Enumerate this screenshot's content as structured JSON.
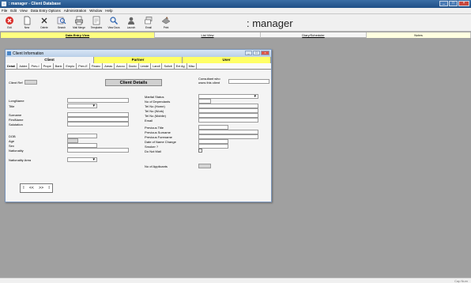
{
  "window": {
    "title": ": manager - Client Database"
  },
  "menu": [
    "File",
    "Edit",
    "View",
    "Data Entry Options",
    "Administration",
    "Window",
    "Help"
  ],
  "toolbar": [
    {
      "label": "Exit",
      "icon": "exit-icon"
    },
    {
      "label": "New",
      "icon": "new-document-icon"
    },
    {
      "label": "Delete",
      "icon": "delete-icon"
    },
    {
      "label": "Search",
      "icon": "search-icon"
    },
    {
      "label": "Mail Merge",
      "icon": "printer-icon"
    },
    {
      "label": "Templates",
      "icon": "templates-icon"
    },
    {
      "label": "View Docs",
      "icon": "view-docs-icon"
    },
    {
      "label": "Launch",
      "icon": "launch-icon"
    },
    {
      "label": "Email",
      "icon": "email-icon"
    },
    {
      "label": "Print",
      "icon": "print-icon"
    }
  ],
  "brand": ": manager",
  "view_tabs": [
    "Data Entry View",
    "List View",
    "Diary/Scheduler",
    "Notes"
  ],
  "child": {
    "title": "Client Information",
    "parties": [
      "Client",
      "Partner",
      "User"
    ],
    "tabs": [
      "Detail",
      "Addre",
      "Prev-I",
      "Prope",
      "Bank",
      "Emplo",
      "Prev-E",
      "Financ",
      "Areas",
      "Accou",
      "Docto",
      "Lende",
      "Landl",
      "Solicit",
      "Ext Ag",
      "Misc"
    ],
    "client_ref_label": "Client Ref",
    "details_button": "Client Details",
    "consultant_label": "Consultant who owns this client",
    "left_fields": [
      "LongName",
      "Title",
      "Surname",
      "FirstName",
      "Salutation",
      "DOB",
      "Age",
      "Sex",
      "Nationality",
      "Nationality Area"
    ],
    "right_fields": [
      "Marital Status",
      "No of Dependants",
      "Tel No (Home)",
      "Tel No (Work)",
      "Tel No (Mobile)",
      "Email",
      "Previous Title",
      "Previous Surname",
      "Previous Forename",
      "Date of Name Change",
      "Smoker ?",
      "Do Not Mail",
      "No of Applicants"
    ],
    "nav": [
      "I",
      "<<",
      ">>",
      "I"
    ]
  },
  "status": {
    "text": "Cap Num"
  }
}
